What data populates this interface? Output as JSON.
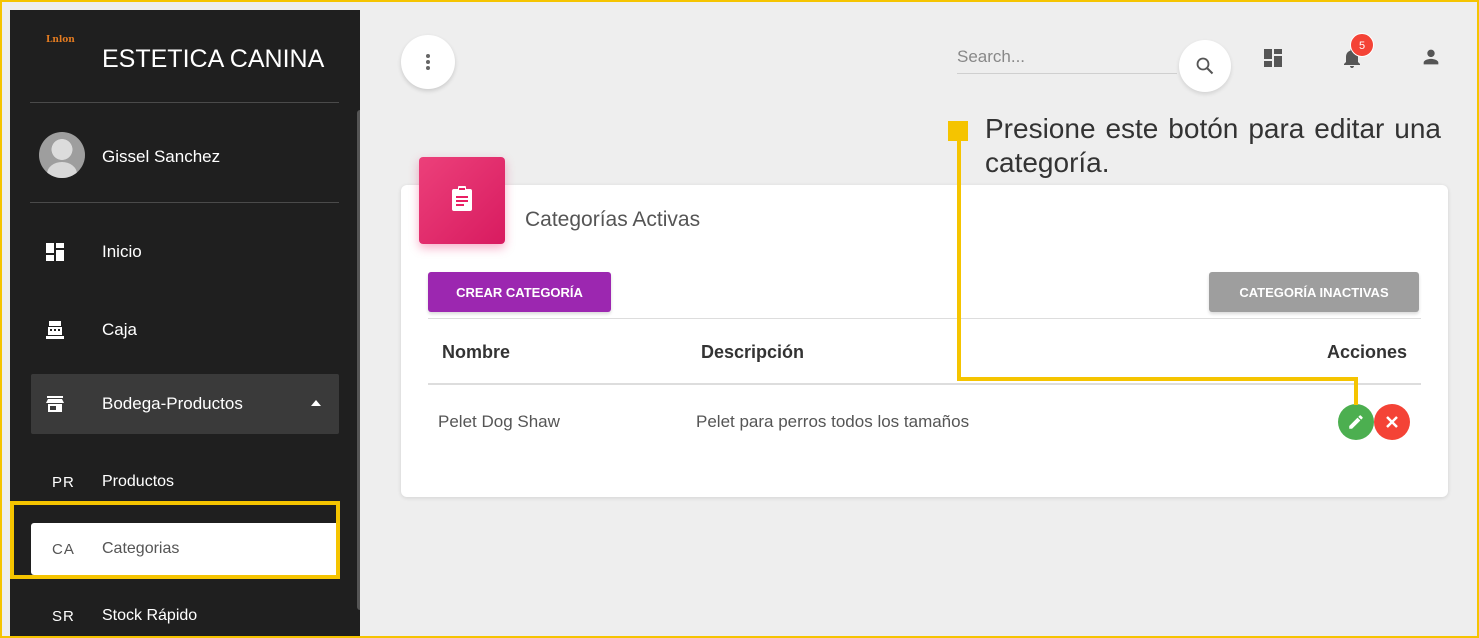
{
  "sidebar": {
    "logo_text": "Lnlon",
    "brand_name": "ESTETICA CANINA",
    "user_name": "Gissel Sanchez",
    "items": [
      {
        "label": "Inicio",
        "icon": "dashboard-icon"
      },
      {
        "label": "Caja",
        "icon": "cash-register-icon"
      },
      {
        "label": "Bodega-Productos",
        "icon": "store-icon",
        "expanded": true
      }
    ],
    "sub_items": [
      {
        "abbr": "PR",
        "label": "Productos"
      },
      {
        "abbr": "CA",
        "label": "Categorias",
        "active": true
      },
      {
        "abbr": "SR",
        "label": "Stock Rápido"
      }
    ]
  },
  "topbar": {
    "search_placeholder": "Search...",
    "notification_count": "5",
    "icons": [
      "more-vert-icon",
      "search-icon",
      "dashboard-icon",
      "notifications-icon",
      "person-icon"
    ]
  },
  "callout": {
    "text": "Presione este botón para editar una categoría."
  },
  "card": {
    "title": "Categorías Activas",
    "create_button": "CREAR CATEGORÍA",
    "inactive_button": "CATEGORÍA INACTIVAS",
    "columns": [
      "Nombre",
      "Descripción",
      "Acciones"
    ],
    "rows": [
      {
        "nombre": "Pelet Dog Shaw",
        "descripcion": "Pelet para perros todos los tamaños"
      }
    ]
  },
  "colors": {
    "highlight": "#f5c400",
    "primary": "#9c27b0",
    "card_icon": "#e91e63",
    "edit": "#4caf50",
    "delete": "#f44336"
  }
}
